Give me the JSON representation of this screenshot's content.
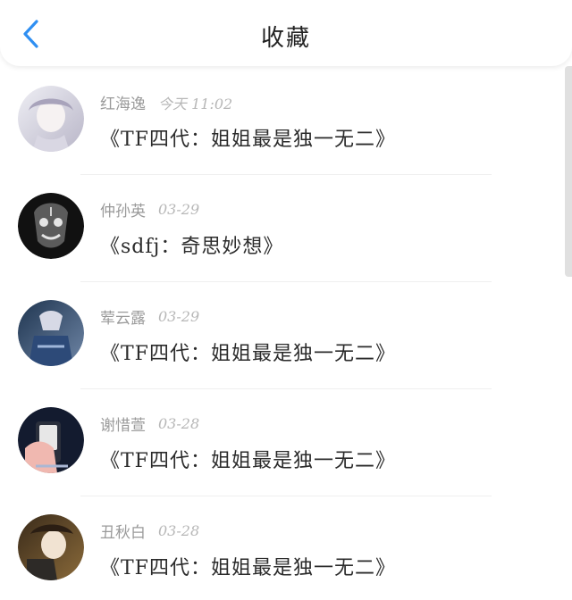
{
  "header": {
    "title": "收藏",
    "back_icon": "chevron-left-icon",
    "accent": "#2f8ff2"
  },
  "items": [
    {
      "author": "红海逸",
      "time": "今天 11:02",
      "title": "《TF四代：姐姐最是独一无二》",
      "avatar_colors": [
        "#eeeef4",
        "#b9b6c8"
      ]
    },
    {
      "author": "仲孙英",
      "time": "03-29",
      "title": "《sdfj：奇思妙想》",
      "avatar_colors": [
        "#111111",
        "#3a3a3a"
      ]
    },
    {
      "author": "荤云露",
      "time": "03-29",
      "title": "《TF四代：姐姐最是独一无二》",
      "avatar_colors": [
        "#1f3550",
        "#6f86a6"
      ]
    },
    {
      "author": "谢惜萱",
      "time": "03-28",
      "title": "《TF四代：姐姐最是独一无二》",
      "avatar_colors": [
        "#131b2f",
        "#3d4f7a"
      ]
    },
    {
      "author": "丑秋白",
      "time": "03-28",
      "title": "《TF四代：姐姐最是独一无二》",
      "avatar_colors": [
        "#3a2b1a",
        "#8a6a3a"
      ]
    }
  ]
}
